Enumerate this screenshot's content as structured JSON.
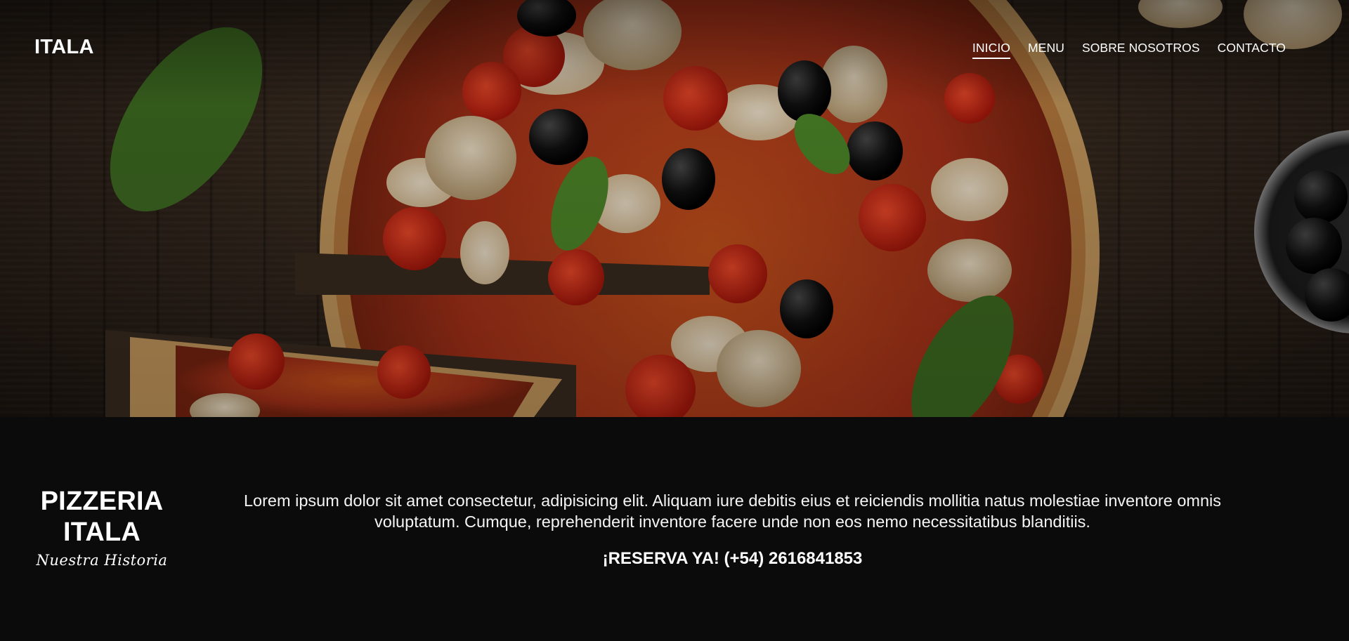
{
  "navbar": {
    "brand": "ITALA",
    "links": [
      {
        "label": "INICIO",
        "active": true
      },
      {
        "label": "MENU",
        "active": false
      },
      {
        "label": "SOBRE NOSOTROS",
        "active": false
      },
      {
        "label": "CONTACTO",
        "active": false
      }
    ]
  },
  "hero": {
    "image": "pizza-on-wooden-table"
  },
  "about": {
    "heading_line1": "PIZZERIA",
    "heading_line2": "ITALA",
    "subtitle": "Nuestra Historia",
    "text": "Lorem ipsum dolor sit amet consectetur, adipisicing elit. Aliquam iure debitis eius et reiciendis mollitia natus molestiae inventore omnis voluptatum. Cumque, reprehenderit inventore facere unde non eos nemo necessitatibus blanditiis.",
    "reserve": "¡RESERVA YA! (+54) 2616841853"
  },
  "colors": {
    "background": "#0b0b0c",
    "text": "#ffffff"
  }
}
